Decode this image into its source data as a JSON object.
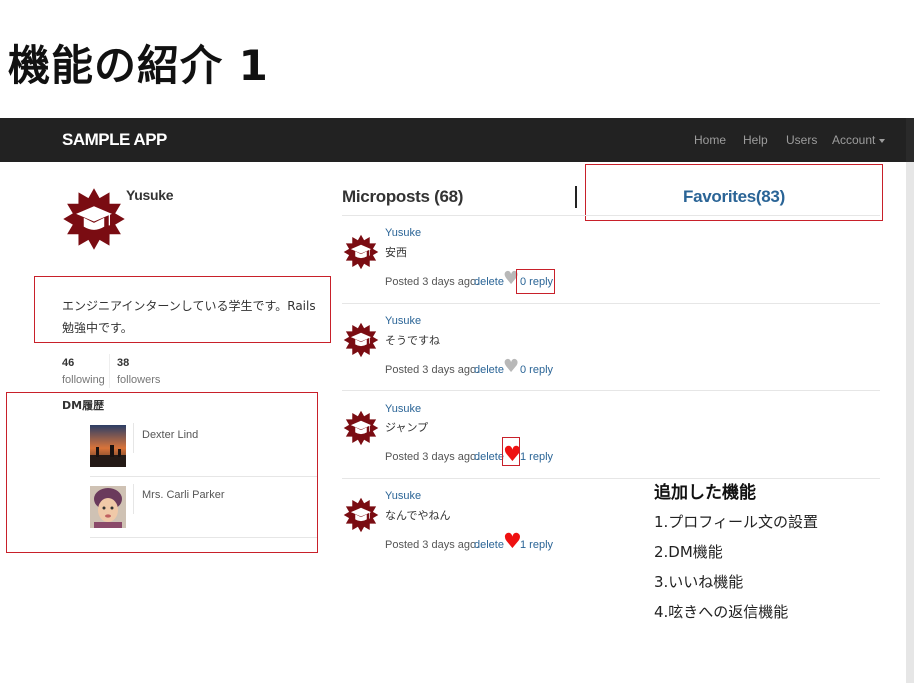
{
  "slide": {
    "title": "機能の紹介 1"
  },
  "navbar": {
    "brand": "SAMPLE APP",
    "links": [
      "Home",
      "Help",
      "Users",
      "Account"
    ]
  },
  "profile": {
    "name": "Yusuke",
    "bio": "エンジニアインターンしている学生です。Rails勉強中です。",
    "following_count": "46",
    "following_label": "following",
    "followers_count": "38",
    "followers_label": "followers"
  },
  "dm": {
    "heading": "DM履歴",
    "contacts": [
      {
        "name": "Dexter Lind"
      },
      {
        "name": "Mrs. Carli Parker"
      }
    ]
  },
  "tabs": {
    "microposts": "Microposts (68)",
    "favorites": "Favorites(83)"
  },
  "posts": [
    {
      "user": "Yusuke",
      "content": "安西",
      "posted": "Posted 3 days ago.",
      "delete": "delete",
      "liked": false,
      "reply": "0 reply"
    },
    {
      "user": "Yusuke",
      "content": "そうですね",
      "posted": "Posted 3 days ago.",
      "delete": "delete",
      "liked": false,
      "reply": "0 reply"
    },
    {
      "user": "Yusuke",
      "content": "ジャンプ",
      "posted": "Posted 3 days ago.",
      "delete": "delete",
      "liked": true,
      "reply": "1 reply"
    },
    {
      "user": "Yusuke",
      "content": "なんでやねん",
      "posted": "Posted 3 days ago.",
      "delete": "delete",
      "liked": true,
      "reply": "1 reply"
    }
  ],
  "features": {
    "title": "追加した機能",
    "items": [
      "1.プロフィール文の設置",
      "2.DM機能",
      "3.いいね機能",
      "4.呟きへの返信機能"
    ]
  },
  "colors": {
    "navbar_bg": "#222222",
    "link": "#2a6496",
    "heart_liked": "#ee1111",
    "heart_unliked": "#b8b8b8",
    "annotation_box": "#c8202a",
    "badge": "#7a0c12"
  }
}
